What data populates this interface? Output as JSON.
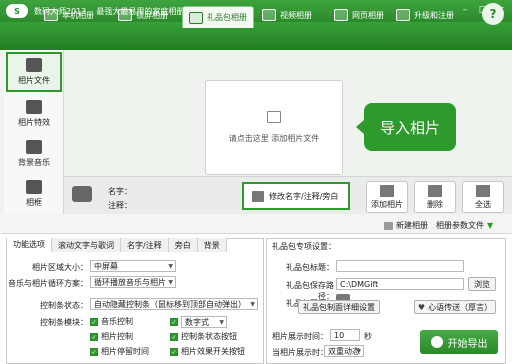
{
  "titlebar": {
    "logo": "S",
    "app_name": "数码大师2013",
    "slogan": "最强大最易用的家庭相册制作软件"
  },
  "nav": {
    "tabs": [
      {
        "label": "本机相册",
        "icon": "photo-icon"
      },
      {
        "label": "锁屏相册",
        "icon": "monitor-icon"
      },
      {
        "label": "礼品包相册",
        "icon": "gift-icon",
        "active": true
      },
      {
        "label": "视频相册",
        "icon": "film-icon"
      },
      {
        "label": "网页相册",
        "icon": "web-icon"
      },
      {
        "label": "升级和注册",
        "icon": "globe-icon"
      }
    ],
    "help": "?"
  },
  "sidebar": {
    "items": [
      {
        "label": "相片文件",
        "icon": "camera-icon",
        "active": true
      },
      {
        "label": "相片特效",
        "icon": "effects-icon"
      },
      {
        "label": "背景音乐",
        "icon": "music-icon"
      },
      {
        "label": "相框",
        "icon": "frame-icon"
      }
    ]
  },
  "dropzone": {
    "text": "请点击这里 添加相片文件"
  },
  "hint": {
    "text": "导入相片"
  },
  "info": {
    "name_label": "名字：",
    "note_label": "注释："
  },
  "edit_button": "修改名字/注释/旁白",
  "actions": [
    {
      "label": "添加相片",
      "icon": "add-photo-icon"
    },
    {
      "label": "删除",
      "icon": "trash-icon"
    },
    {
      "label": "全选",
      "icon": "select-all-icon"
    }
  ],
  "albumbar": {
    "new_album": "新建相册",
    "album_params": "相册参数文件"
  },
  "settings": {
    "tabs": [
      "功能选项",
      "滚动文字与歌词",
      "名字/注释",
      "旁白",
      "背景"
    ],
    "rows": [
      {
        "label": "相片区域大小：",
        "value": "中屏幕"
      },
      {
        "label": "音乐与相片循环方案：",
        "value": "循环播放音乐与相片"
      },
      {
        "label": "控制条状态：",
        "value": "自动隐藏控制条（鼠标移到顶部自动弹出）"
      }
    ],
    "control_module_label": "控制条模块：",
    "checks": [
      {
        "label": "音乐控制",
        "checked": true
      },
      {
        "label": "数字式",
        "checked": true,
        "is_select": true
      },
      {
        "label": "相片控制",
        "checked": true
      },
      {
        "label": "控制条状态按钮",
        "checked": true
      },
      {
        "label": "相片停留时间",
        "checked": true
      },
      {
        "label": "相片效果开关按钮",
        "checked": true
      }
    ]
  },
  "gift": {
    "title": "礼品包专项设置：",
    "title_label": "礼品包标题：",
    "path_label": "礼品包保存路径：",
    "path_value": "C:\\DMGift",
    "browse": "浏览",
    "icon_label": "礼品包图标：",
    "detail_btn": "礼品包制面详细设置",
    "share_btn": "心语传送（厚言）",
    "display_time_label": "相片展示时间：",
    "display_time_value": "10",
    "display_time_unit": "秒",
    "display_mode_label": "当相片展示时：",
    "display_mode_value": "双重动态",
    "export": "开始导出"
  }
}
